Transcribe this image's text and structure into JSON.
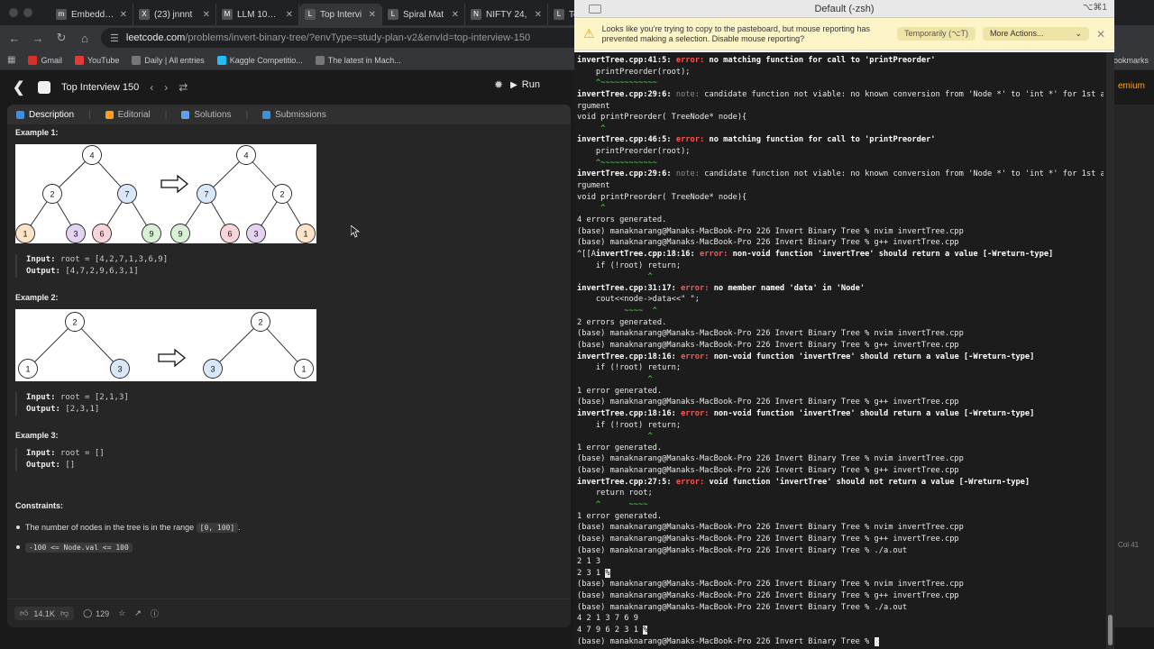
{
  "browser": {
    "tabs": [
      {
        "title": "Embedding",
        "icon": "m"
      },
      {
        "title": "(23) jnnnt",
        "icon": "X"
      },
      {
        "title": "LLM 101: E",
        "icon": "M"
      },
      {
        "title": "Top Intervi",
        "icon": "L"
      },
      {
        "title": "Spiral Mat",
        "icon": "L"
      },
      {
        "title": "NIFTY 24,",
        "icon": "N"
      },
      {
        "title": "Top Int",
        "icon": "L"
      }
    ],
    "url_host": "leetcode.com",
    "url_path": "/problems/invert-binary-tree/?envType=study-plan-v2&envId=top-interview-150",
    "bookmarks": [
      {
        "label": "Gmail",
        "cls": "gm"
      },
      {
        "label": "YouTube",
        "cls": "yt"
      },
      {
        "label": "Daily | All entries",
        "cls": ""
      },
      {
        "label": "Kaggle Competitio...",
        "cls": "kg"
      },
      {
        "label": "The latest in Mach...",
        "cls": ""
      }
    ],
    "all_bookmarks": "ookmarks"
  },
  "leetcode": {
    "list_title": "Top Interview 150",
    "run_label": "Run",
    "premium": "emium",
    "panel_tabs": [
      "Description",
      "Editorial",
      "Solutions",
      "Submissions"
    ],
    "examples": [
      {
        "title": "Example 1:",
        "input_label": "Input:",
        "input": "root = [4,2,7,1,3,6,9]",
        "output_label": "Output:",
        "output": "[4,7,2,9,6,3,1]"
      },
      {
        "title": "Example 2:",
        "input_label": "Input:",
        "input": "root = [2,1,3]",
        "output_label": "Output:",
        "output": "[2,3,1]"
      },
      {
        "title": "Example 3:",
        "input_label": "Input:",
        "input": "root = []",
        "output_label": "Output:",
        "output": "[]"
      }
    ],
    "tree1_left": [
      {
        "v": "4",
        "fill": "#ffffff"
      },
      {
        "v": "2",
        "fill": "#ffffff"
      },
      {
        "v": "7",
        "fill": "#d9e7fb"
      },
      {
        "v": "1",
        "fill": "#fde3c8"
      },
      {
        "v": "3",
        "fill": "#e4d3f0"
      },
      {
        "v": "6",
        "fill": "#f9d4d8"
      },
      {
        "v": "9",
        "fill": "#d9efd6"
      }
    ],
    "tree1_right": [
      {
        "v": "4",
        "fill": "#ffffff"
      },
      {
        "v": "7",
        "fill": "#d9e7fb"
      },
      {
        "v": "2",
        "fill": "#ffffff"
      },
      {
        "v": "9",
        "fill": "#d9efd6"
      },
      {
        "v": "6",
        "fill": "#f9d4d8"
      },
      {
        "v": "3",
        "fill": "#e4d3f0"
      },
      {
        "v": "1",
        "fill": "#fde3c8"
      }
    ],
    "tree2_left": [
      {
        "v": "2",
        "fill": "#ffffff"
      },
      {
        "v": "1",
        "fill": "#ffffff"
      },
      {
        "v": "3",
        "fill": "#d9e7fb"
      }
    ],
    "tree2_right": [
      {
        "v": "2",
        "fill": "#ffffff"
      },
      {
        "v": "3",
        "fill": "#d9e7fb"
      },
      {
        "v": "1",
        "fill": "#ffffff"
      }
    ],
    "constraints_title": "Constraints:",
    "constraint1_pre": "The number of nodes in the tree is in the range ",
    "constraint1_code": "[0, 100]",
    "constraint1_post": ".",
    "constraint2_code": "-100 <= Node.val <= 100",
    "likes": "14.1K",
    "comments": "129",
    "col": "Col 41"
  },
  "terminal": {
    "title": "Default (-zsh)",
    "shortcut": "⌥⌘1",
    "banner_msg": "Looks like you're trying to copy to the pasteboard, but mouse reporting has prevented making a selection. Disable mouse reporting?",
    "banner_btn1": "Temporarily (⌥T)",
    "banner_btn2": "More Actions...",
    "lines": [
      [
        {
          "t": "invertTree.cpp:41:5: ",
          "c": "t-b"
        },
        {
          "t": "error: ",
          "c": "t-err"
        },
        {
          "t": "no matching function for call to 'printPreorder'",
          "c": "t-b"
        }
      ],
      [
        {
          "t": "    printPreorder(root);",
          "c": ""
        }
      ],
      [
        {
          "t": "    ^~~~~~~~~~~~~",
          "c": "t-g"
        }
      ],
      [
        {
          "t": "invertTree.cpp:29:6: ",
          "c": "t-b"
        },
        {
          "t": "note: ",
          "c": "t-note"
        },
        {
          "t": "candidate function not viable: no known conversion from 'Node *' to 'int *' for 1st a",
          "c": ""
        }
      ],
      [
        {
          "t": "rgument",
          "c": ""
        }
      ],
      [
        {
          "t": "void printPreorder( TreeNode* node){",
          "c": ""
        }
      ],
      [
        {
          "t": "     ^",
          "c": "t-g"
        }
      ],
      [
        {
          "t": "invertTree.cpp:46:5: ",
          "c": "t-b"
        },
        {
          "t": "error: ",
          "c": "t-err"
        },
        {
          "t": "no matching function for call to 'printPreorder'",
          "c": "t-b"
        }
      ],
      [
        {
          "t": "    printPreorder(root);",
          "c": ""
        }
      ],
      [
        {
          "t": "    ^~~~~~~~~~~~~",
          "c": "t-g"
        }
      ],
      [
        {
          "t": "invertTree.cpp:29:6: ",
          "c": "t-b"
        },
        {
          "t": "note: ",
          "c": "t-note"
        },
        {
          "t": "candidate function not viable: no known conversion from 'Node *' to 'int *' for 1st a",
          "c": ""
        }
      ],
      [
        {
          "t": "rgument",
          "c": ""
        }
      ],
      [
        {
          "t": "void printPreorder( TreeNode* node){",
          "c": ""
        }
      ],
      [
        {
          "t": "     ^",
          "c": "t-g"
        }
      ],
      [
        {
          "t": "4 errors generated.",
          "c": ""
        }
      ],
      [
        {
          "t": "(base) manaknarang@Manaks-MacBook-Pro 226 Invert Binary Tree % nvim invertTree.cpp",
          "c": ""
        }
      ],
      [
        {
          "t": "(base) manaknarang@Manaks-MacBook-Pro 226 Invert Binary Tree % g++ invertTree.cpp",
          "c": ""
        }
      ],
      [
        {
          "t": "^[[A",
          "c": ""
        },
        {
          "t": "invertTree.cpp:18:16: ",
          "c": "t-b"
        },
        {
          "t": "error: ",
          "c": "t-err"
        },
        {
          "t": "non-void function 'invertTree' should return a value [-Wreturn-type]",
          "c": "t-b"
        }
      ],
      [
        {
          "t": "    if (!root) return;",
          "c": ""
        }
      ],
      [
        {
          "t": "               ^",
          "c": "t-g"
        }
      ],
      [
        {
          "t": "invertTree.cpp:31:17: ",
          "c": "t-b"
        },
        {
          "t": "error: ",
          "c": "t-err"
        },
        {
          "t": "no member named 'data' in 'Node'",
          "c": "t-b"
        }
      ],
      [
        {
          "t": "    cout<<node->data<<\" \";",
          "c": ""
        }
      ],
      [
        {
          "t": "          ~~~~  ^",
          "c": "t-g"
        }
      ],
      [
        {
          "t": "2 errors generated.",
          "c": ""
        }
      ],
      [
        {
          "t": "(base) manaknarang@Manaks-MacBook-Pro 226 Invert Binary Tree % nvim invertTree.cpp",
          "c": ""
        }
      ],
      [
        {
          "t": "(base) manaknarang@Manaks-MacBook-Pro 226 Invert Binary Tree % g++ invertTree.cpp",
          "c": ""
        }
      ],
      [
        {
          "t": "invertTree.cpp:18:16: ",
          "c": "t-b"
        },
        {
          "t": "error: ",
          "c": "t-err"
        },
        {
          "t": "non-void function 'invertTree' should return a value [-Wreturn-type]",
          "c": "t-b"
        }
      ],
      [
        {
          "t": "    if (!root) return;",
          "c": ""
        }
      ],
      [
        {
          "t": "               ^",
          "c": "t-g"
        }
      ],
      [
        {
          "t": "1 error generated.",
          "c": ""
        }
      ],
      [
        {
          "t": "(base) manaknarang@Manaks-MacBook-Pro 226 Invert Binary Tree % g++ invertTree.cpp",
          "c": ""
        }
      ],
      [
        {
          "t": "invertTree.cpp:18:16: ",
          "c": "t-b"
        },
        {
          "t": "error: ",
          "c": "t-err"
        },
        {
          "t": "non-void function 'invertTree' should return a value [-Wreturn-type]",
          "c": "t-b"
        }
      ],
      [
        {
          "t": "    if (!root) return;",
          "c": ""
        }
      ],
      [
        {
          "t": "               ^",
          "c": "t-g"
        }
      ],
      [
        {
          "t": "1 error generated.",
          "c": ""
        }
      ],
      [
        {
          "t": "(base) manaknarang@Manaks-MacBook-Pro 226 Invert Binary Tree % nvim invertTree.cpp",
          "c": ""
        }
      ],
      [
        {
          "t": "(base) manaknarang@Manaks-MacBook-Pro 226 Invert Binary Tree % g++ invertTree.cpp",
          "c": ""
        }
      ],
      [
        {
          "t": "invertTree.cpp:27:5: ",
          "c": "t-b"
        },
        {
          "t": "error: ",
          "c": "t-err"
        },
        {
          "t": "void function 'invertTree' should not return a value [-Wreturn-type]",
          "c": "t-b"
        }
      ],
      [
        {
          "t": "    return root;",
          "c": ""
        }
      ],
      [
        {
          "t": "    ^      ~~~~",
          "c": "t-g"
        }
      ],
      [
        {
          "t": "1 error generated.",
          "c": ""
        }
      ],
      [
        {
          "t": "(base) manaknarang@Manaks-MacBook-Pro 226 Invert Binary Tree % nvim invertTree.cpp",
          "c": ""
        }
      ],
      [
        {
          "t": "(base) manaknarang@Manaks-MacBook-Pro 226 Invert Binary Tree % g++ invertTree.cpp",
          "c": ""
        }
      ],
      [
        {
          "t": "(base) manaknarang@Manaks-MacBook-Pro 226 Invert Binary Tree % ./a.out",
          "c": ""
        }
      ],
      [
        {
          "t": "2 1 3",
          "c": ""
        }
      ],
      [
        {
          "t": "2 3 1 ",
          "c": ""
        },
        {
          "t": "%",
          "c": "t-cur"
        }
      ],
      [
        {
          "t": "(base) manaknarang@Manaks-MacBook-Pro 226 Invert Binary Tree % nvim invertTree.cpp",
          "c": ""
        }
      ],
      [
        {
          "t": "(base) manaknarang@Manaks-MacBook-Pro 226 Invert Binary Tree % g++ invertTree.cpp",
          "c": ""
        }
      ],
      [
        {
          "t": "(base) manaknarang@Manaks-MacBook-Pro 226 Invert Binary Tree % ./a.out",
          "c": ""
        }
      ],
      [
        {
          "t": "4 2 1 3 7 6 9",
          "c": ""
        }
      ],
      [
        {
          "t": "4 7 9 6 2 3 1 ",
          "c": ""
        },
        {
          "t": "%",
          "c": "t-cur"
        }
      ],
      [
        {
          "t": "(base) manaknarang@Manaks-MacBook-Pro 226 Invert Binary Tree % ",
          "c": ""
        },
        {
          "t": " ",
          "c": "t-cur"
        }
      ]
    ]
  }
}
